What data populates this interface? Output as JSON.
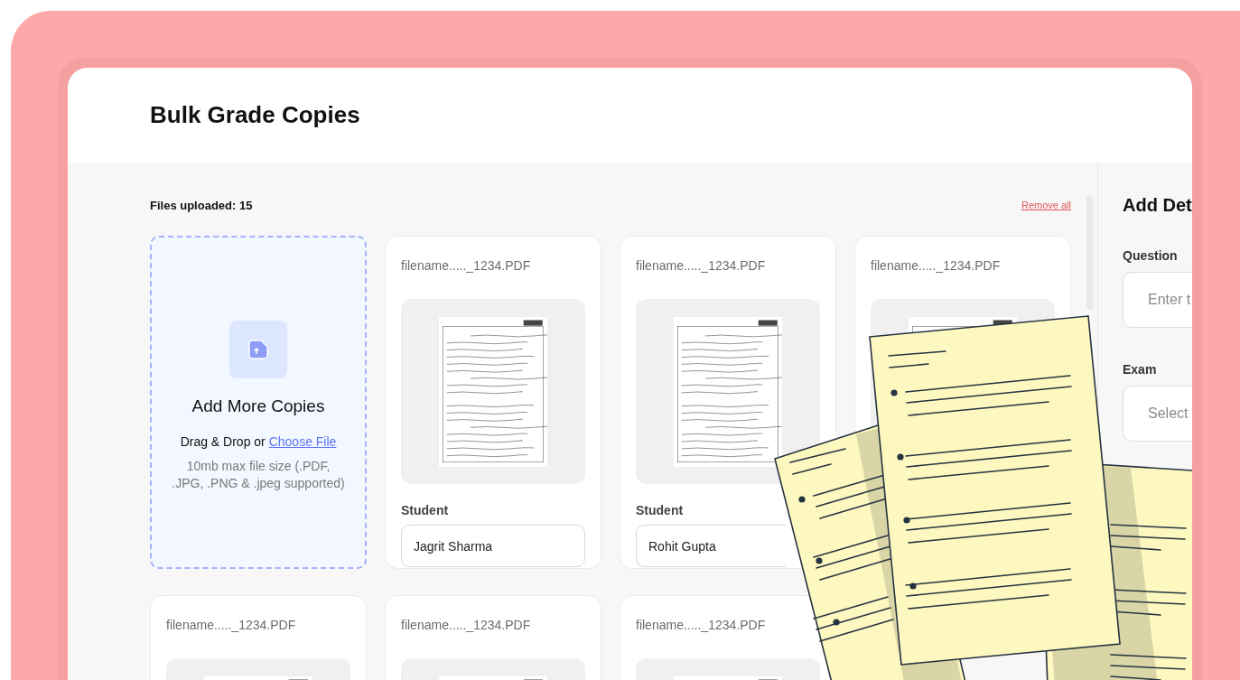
{
  "header": {
    "title": "Bulk Grade Copies"
  },
  "files": {
    "count_label": "Files uploaded: 15",
    "remove_all": "Remove all"
  },
  "upload": {
    "title": "Add More Copies",
    "drag_text": "Drag & Drop or",
    "link": "Choose File",
    "hint": "10mb max file size (.PDF, .JPG, .PNG & .jpeg supported)"
  },
  "cards": [
    {
      "filename": "filename....._1234.PDF",
      "student_label": "Student",
      "student_value": "Jagrit Sharma"
    },
    {
      "filename": "filename....._1234.PDF",
      "student_label": "Student",
      "student_value": "Rohit Gupta"
    },
    {
      "filename": "filename....._1234.PDF"
    },
    {
      "filename": "filename....._1234.PDF"
    },
    {
      "filename": "filename....._1234.PDF"
    },
    {
      "filename": "filename....._1234.PDF"
    }
  ],
  "details": {
    "title": "Add Det",
    "fields": [
      {
        "label": "Question",
        "placeholder": "Enter t"
      },
      {
        "label": "Exam",
        "placeholder": "Select"
      }
    ]
  }
}
